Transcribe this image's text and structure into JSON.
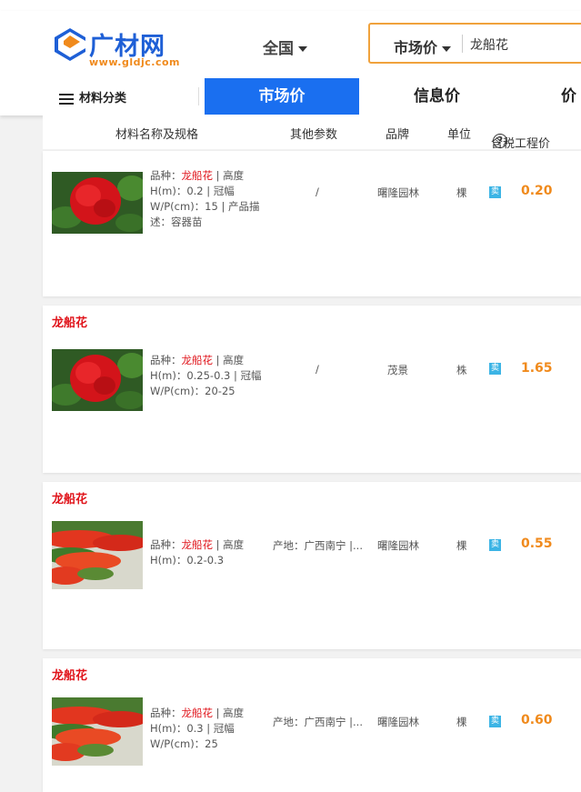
{
  "brand": {
    "name": "广材网",
    "url": "www.gldjc.com",
    "colors": {
      "blue": "#1e5fd6",
      "orange": "#f08a1c"
    }
  },
  "header": {
    "region": "全国",
    "search_type": "市场价",
    "search_value": "龙船花"
  },
  "nav": {
    "category_label": "材料分类",
    "tabs": [
      "市场价",
      "信息价",
      "价格"
    ],
    "active_tab": "市场价"
  },
  "columns": {
    "name": "材料名称及规格",
    "params": "其他参数",
    "brand": "品牌",
    "unit": "单位",
    "price": "含税工程价"
  },
  "products": [
    {
      "title": "",
      "spec_prefix": "品种：",
      "variety": "龙船花",
      "spec_rest": " | 高度 H(m)：0.2 | 冠幅 W/P(cm)：15 | 产品描述：容器苗",
      "params": "/",
      "brand": "曙隆园林",
      "unit": "棵",
      "sell": "卖",
      "price": "0.20",
      "image": "red-flower-cluster"
    },
    {
      "title": "龙船花",
      "spec_prefix": "品种：",
      "variety": "龙船花",
      "spec_rest": " | 高度 H(m)：0.25-0.3 | 冠幅 W/P(cm)：20-25",
      "params": "/",
      "brand": "茂景",
      "unit": "株",
      "sell": "卖",
      "price": "1.65",
      "image": "red-flower-cluster"
    },
    {
      "title": "龙船花",
      "spec_prefix": "品种：",
      "variety": "龙船花",
      "spec_rest": " | 高度 H(m)：0.2-0.3",
      "params": "产地：广西南宁 |...",
      "brand": "曙隆园林",
      "unit": "棵",
      "sell": "卖",
      "price": "0.55",
      "image": "flower-hedge"
    },
    {
      "title": "龙船花",
      "spec_prefix": "品种：",
      "variety": "龙船花",
      "spec_rest": " | 高度 H(m)：0.3 | 冠幅 W/P(cm)：25",
      "params": "产地：广西南宁 |...",
      "brand": "曙隆园林",
      "unit": "棵",
      "sell": "卖",
      "price": "0.60",
      "image": "flower-hedge"
    }
  ]
}
